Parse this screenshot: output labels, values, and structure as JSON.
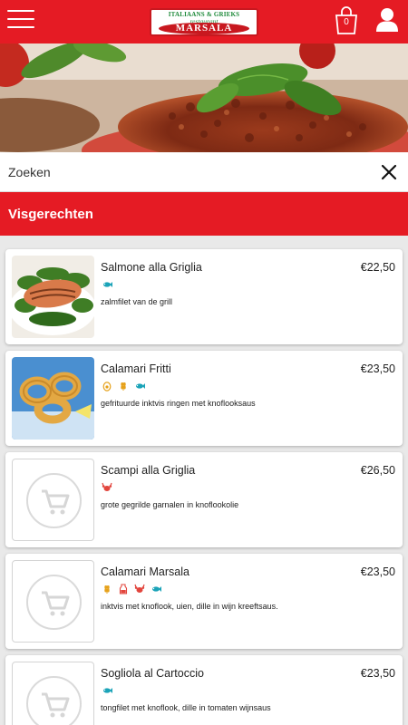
{
  "header": {
    "logo": {
      "line1": "ITALIAANS & GRIEKS",
      "line2": "restaurant",
      "line3": "MARSALA"
    },
    "cart_count": "0"
  },
  "search": {
    "placeholder": "Zoeken"
  },
  "category": {
    "title": "Visgerechten"
  },
  "items": [
    {
      "name": "Salmone alla Griglia",
      "price": "€22,50",
      "description": "zalmfilet van de grill",
      "allergen_icons": [
        "fish-icon"
      ],
      "image": "salmon-photo"
    },
    {
      "name": "Calamari Fritti",
      "price": "€23,50",
      "description": "gefrituurde inktvis ringen met knoflooksaus",
      "allergen_icons": [
        "egg-icon",
        "gluten-icon",
        "fish-icon"
      ],
      "image": "calamari-photo"
    },
    {
      "name": "Scampi alla Griglia",
      "price": "€26,50",
      "description": "grote gegrilde garnalen in knoflookolie",
      "allergen_icons": [
        "shellfish-icon"
      ],
      "image": "placeholder-cart"
    },
    {
      "name": "Calamari Marsala",
      "price": "€23,50",
      "description": "inktvis met knoflook, uien, dille in wijn kreeftsaus.",
      "allergen_icons": [
        "gluten-icon",
        "milk-icon",
        "shellfish-icon",
        "fish-icon"
      ],
      "image": "placeholder-cart"
    },
    {
      "name": "Sogliola al Cartoccio",
      "price": "€23,50",
      "description": "tongfilet met knoflook, dille in tomaten wijnsaus",
      "allergen_icons": [
        "fish-icon"
      ],
      "image": "placeholder-cart"
    }
  ],
  "colors": {
    "primary_red": "#e51b24",
    "fish_icon": "#1aa3b8",
    "egg_icon": "#e6a11a",
    "gluten_icon": "#e6a11a",
    "shellfish_icon": "#e2453d",
    "milk_icon": "#e2453d"
  }
}
